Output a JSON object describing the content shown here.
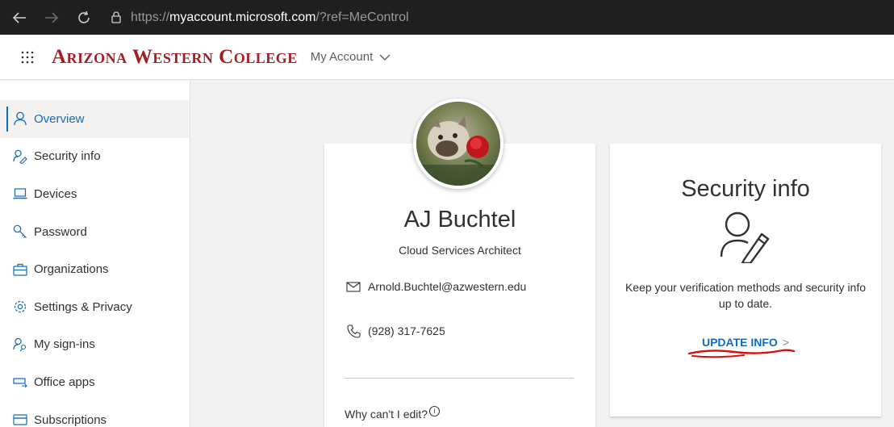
{
  "browser": {
    "url_prefix": "https://",
    "url_host": "myaccount.microsoft.com",
    "url_rest": "/?ref=MeControl",
    "icons": [
      "back-icon",
      "forward-icon",
      "refresh-icon",
      "lock-icon"
    ]
  },
  "header": {
    "brand": "Arizona Western College",
    "account_menu": "My Account",
    "brand_color": "#a41e22"
  },
  "sidebar": {
    "items": [
      {
        "label": "Overview",
        "icon": "person-icon",
        "active": true
      },
      {
        "label": "Security info",
        "icon": "person-key-icon",
        "active": false
      },
      {
        "label": "Devices",
        "icon": "laptop-icon",
        "active": false
      },
      {
        "label": "Password",
        "icon": "key-icon",
        "active": false
      },
      {
        "label": "Organizations",
        "icon": "briefcase-icon",
        "active": false
      },
      {
        "label": "Settings & Privacy",
        "icon": "gear-icon",
        "active": false
      },
      {
        "label": "My sign-ins",
        "icon": "person-key-icon",
        "active": false
      },
      {
        "label": "Office apps",
        "icon": "office-apps-icon",
        "active": false
      },
      {
        "label": "Subscriptions",
        "icon": "card-icon",
        "active": false
      }
    ]
  },
  "profile": {
    "name": "AJ Buchtel",
    "job_title": "Cloud Services Architect",
    "email": "Arnold.Buchtel@azwestern.edu",
    "phone": "(928) 317-7625",
    "why_edit": "Why can't I edit?",
    "avatar": "avatar-photo"
  },
  "security_card": {
    "title": "Security info",
    "description": "Keep your verification methods and security info up to date.",
    "link": "UPDATE INFO",
    "link_arrow": ">",
    "accent_color": "#0f6cbd",
    "annotation_color": "#d80e0e"
  }
}
